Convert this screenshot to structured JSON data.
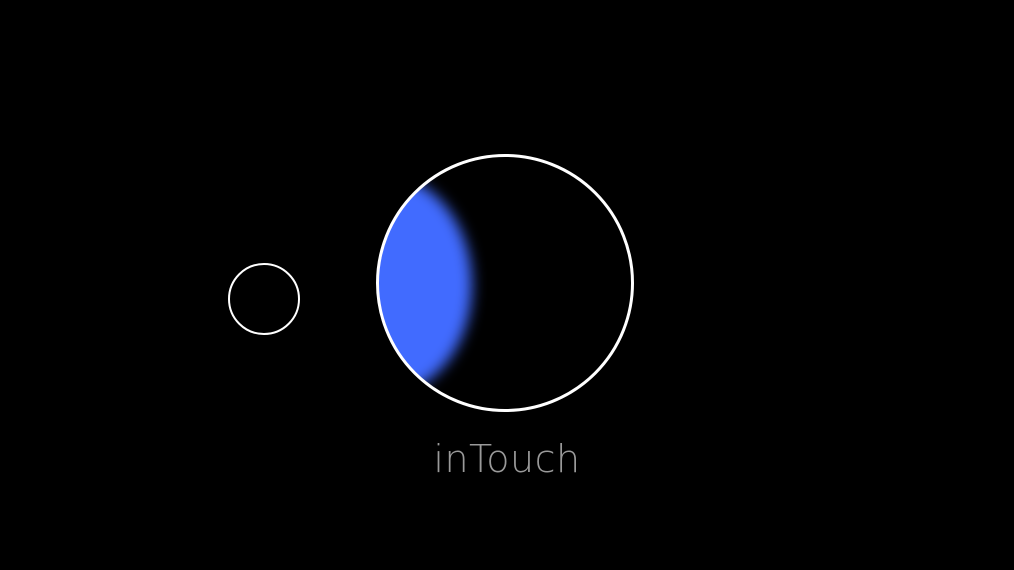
{
  "app": {
    "title": "inTouch"
  },
  "colors": {
    "background": "#000000",
    "accent": "#416bff",
    "ring": "#ffffff",
    "title_text": "#9a9a9a"
  },
  "icons": {
    "small_circle": "small-circle-icon",
    "main_orb": "orb-icon"
  },
  "orb": {
    "fill_fraction": 0.35
  }
}
